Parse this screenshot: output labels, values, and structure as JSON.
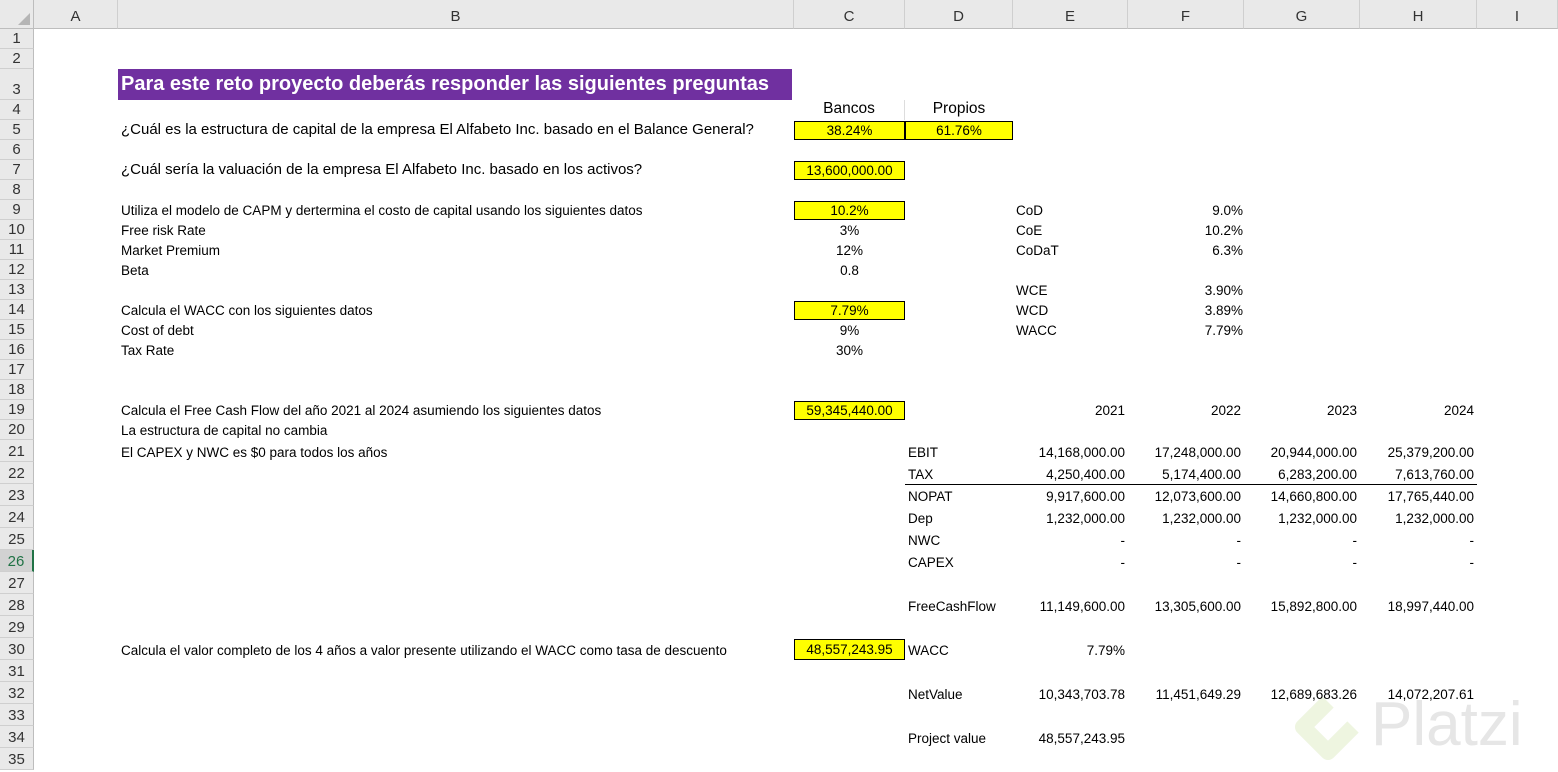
{
  "columns": [
    "A",
    "B",
    "C",
    "D",
    "E",
    "F",
    "G",
    "H",
    "I"
  ],
  "rows": [
    1,
    2,
    3,
    4,
    5,
    6,
    7,
    8,
    9,
    10,
    11,
    12,
    13,
    14,
    15,
    16,
    17,
    18,
    19,
    20,
    21,
    22,
    23,
    24,
    25,
    26,
    27,
    28,
    29,
    30,
    31,
    32,
    33,
    34,
    35
  ],
  "selected_row": 26,
  "cells": [
    {
      "cell": "B3",
      "value": "Para este reto proyecto deberás responder las siguientes preguntas"
    },
    {
      "cell": "C4",
      "value": "Bancos"
    },
    {
      "cell": "D4",
      "value": "Propios"
    },
    {
      "cell": "B5",
      "value": "¿Cuál es la estructura de capital de la empresa El Alfabeto Inc. basado en el Balance General?"
    },
    {
      "cell": "C5",
      "value": "38.24%"
    },
    {
      "cell": "D5",
      "value": "61.76%"
    },
    {
      "cell": "B7",
      "value": "¿Cuál sería la valuación de la empresa El Alfabeto Inc. basado en los activos?"
    },
    {
      "cell": "C7",
      "value": "13,600,000.00"
    },
    {
      "cell": "B9",
      "value": "Utiliza el modelo de CAPM y dertermina el costo de capital usando los siguientes datos"
    },
    {
      "cell": "C9",
      "value": "10.2%"
    },
    {
      "cell": "E9",
      "value": "CoD"
    },
    {
      "cell": "F9",
      "value": "9.0%"
    },
    {
      "cell": "B10",
      "value": "Free risk Rate"
    },
    {
      "cell": "C10",
      "value": "3%"
    },
    {
      "cell": "E10",
      "value": "CoE"
    },
    {
      "cell": "F10",
      "value": "10.2%"
    },
    {
      "cell": "B11",
      "value": "Market Premium"
    },
    {
      "cell": "C11",
      "value": "12%"
    },
    {
      "cell": "E11",
      "value": "CoDaT"
    },
    {
      "cell": "F11",
      "value": "6.3%"
    },
    {
      "cell": "B12",
      "value": "Beta"
    },
    {
      "cell": "C12",
      "value": "0.8"
    },
    {
      "cell": "E13",
      "value": "WCE"
    },
    {
      "cell": "F13",
      "value": "3.90%"
    },
    {
      "cell": "B14",
      "value": "Calcula el WACC con los siguientes datos"
    },
    {
      "cell": "C14",
      "value": "7.79%"
    },
    {
      "cell": "E14",
      "value": "WCD"
    },
    {
      "cell": "F14",
      "value": "3.89%"
    },
    {
      "cell": "B15",
      "value": "Cost of debt"
    },
    {
      "cell": "C15",
      "value": "9%"
    },
    {
      "cell": "E15",
      "value": "WACC"
    },
    {
      "cell": "F15",
      "value": "7.79%"
    },
    {
      "cell": "B16",
      "value": "Tax Rate"
    },
    {
      "cell": "C16",
      "value": "30%"
    },
    {
      "cell": "B19",
      "value": "Calcula el Free Cash Flow del año 2021 al 2024 asumiendo los siguientes datos"
    },
    {
      "cell": "C19",
      "value": "59,345,440.00"
    },
    {
      "cell": "E19",
      "value": "2021"
    },
    {
      "cell": "F19",
      "value": "2022"
    },
    {
      "cell": "G19",
      "value": "2023"
    },
    {
      "cell": "H19",
      "value": "2024"
    },
    {
      "cell": "B20",
      "value": "La estructura de capital no cambia"
    },
    {
      "cell": "B21",
      "value": "El CAPEX y NWC  es $0 para todos los años"
    },
    {
      "cell": "D21",
      "value": "EBIT"
    },
    {
      "cell": "E21",
      "value": "14,168,000.00"
    },
    {
      "cell": "F21",
      "value": "17,248,000.00"
    },
    {
      "cell": "G21",
      "value": "20,944,000.00"
    },
    {
      "cell": "H21",
      "value": "25,379,200.00"
    },
    {
      "cell": "D22",
      "value": "TAX"
    },
    {
      "cell": "E22",
      "value": "4,250,400.00"
    },
    {
      "cell": "F22",
      "value": "5,174,400.00"
    },
    {
      "cell": "G22",
      "value": "6,283,200.00"
    },
    {
      "cell": "H22",
      "value": "7,613,760.00"
    },
    {
      "cell": "D23",
      "value": "NOPAT"
    },
    {
      "cell": "E23",
      "value": "9,917,600.00"
    },
    {
      "cell": "F23",
      "value": "12,073,600.00"
    },
    {
      "cell": "G23",
      "value": "14,660,800.00"
    },
    {
      "cell": "H23",
      "value": "17,765,440.00"
    },
    {
      "cell": "D24",
      "value": "Dep"
    },
    {
      "cell": "E24",
      "value": "1,232,000.00"
    },
    {
      "cell": "F24",
      "value": "1,232,000.00"
    },
    {
      "cell": "G24",
      "value": "1,232,000.00"
    },
    {
      "cell": "H24",
      "value": "1,232,000.00"
    },
    {
      "cell": "D25",
      "value": "NWC"
    },
    {
      "cell": "E25",
      "value": "-"
    },
    {
      "cell": "F25",
      "value": "-"
    },
    {
      "cell": "G25",
      "value": "-"
    },
    {
      "cell": "H25",
      "value": "-"
    },
    {
      "cell": "D26",
      "value": "CAPEX"
    },
    {
      "cell": "E26",
      "value": "-"
    },
    {
      "cell": "F26",
      "value": "-"
    },
    {
      "cell": "G26",
      "value": "-"
    },
    {
      "cell": "H26",
      "value": "-"
    },
    {
      "cell": "D28",
      "value": "FreeCashFlow"
    },
    {
      "cell": "E28",
      "value": "11,149,600.00"
    },
    {
      "cell": "F28",
      "value": "13,305,600.00"
    },
    {
      "cell": "G28",
      "value": "15,892,800.00"
    },
    {
      "cell": "H28",
      "value": "18,997,440.00"
    },
    {
      "cell": "B30",
      "value": "Calcula el valor completo de los 4 años a valor presente utilizando el WACC como tasa de descuento"
    },
    {
      "cell": "C30",
      "value": "48,557,243.95"
    },
    {
      "cell": "D30",
      "value": "WACC"
    },
    {
      "cell": "E30",
      "value": "7.79%"
    },
    {
      "cell": "D32",
      "value": "NetValue"
    },
    {
      "cell": "E32",
      "value": "10,343,703.78"
    },
    {
      "cell": "F32",
      "value": "11,451,649.29"
    },
    {
      "cell": "G32",
      "value": "12,689,683.26"
    },
    {
      "cell": "H32",
      "value": "14,072,207.61"
    },
    {
      "cell": "D34",
      "value": "Project value"
    },
    {
      "cell": "E34",
      "value": "48,557,243.95"
    }
  ],
  "watermark": {
    "text": "Platzi",
    "color": "#e8e8e8",
    "accent": "#eef5e0"
  }
}
